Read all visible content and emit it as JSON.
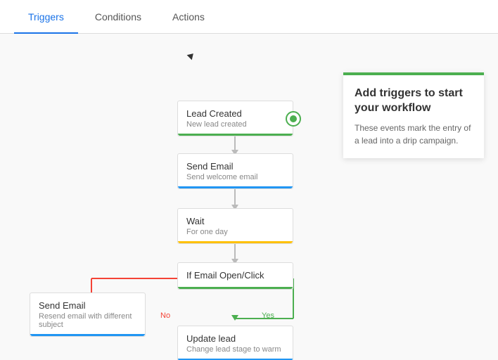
{
  "tabs": [
    {
      "id": "triggers",
      "label": "Triggers",
      "active": true
    },
    {
      "id": "conditions",
      "label": "Conditions",
      "active": false
    },
    {
      "id": "actions",
      "label": "Actions",
      "active": false
    }
  ],
  "nodes": [
    {
      "id": "lead-created",
      "title": "Lead Created",
      "subtitle": "New lead created",
      "bar": "green",
      "hasIcon": true
    },
    {
      "id": "send-email",
      "title": "Send Email",
      "subtitle": "Send welcome email",
      "bar": "blue"
    },
    {
      "id": "wait",
      "title": "Wait",
      "subtitle": "For one day",
      "bar": "yellow"
    },
    {
      "id": "if-email",
      "title": "If Email Open/Click",
      "subtitle": "",
      "bar": "green"
    },
    {
      "id": "resend-email",
      "title": "Send Email",
      "subtitle": "Resend email with different subject",
      "bar": "blue"
    },
    {
      "id": "update-lead",
      "title": "Update lead",
      "subtitle": "Change lead stage to warm",
      "bar": "blue"
    }
  ],
  "labels": {
    "yes": "Yes",
    "no": "No"
  },
  "tooltip": {
    "title": "Add triggers to start your workflow",
    "description": "These events mark the entry of a lead into a drip campaign."
  }
}
